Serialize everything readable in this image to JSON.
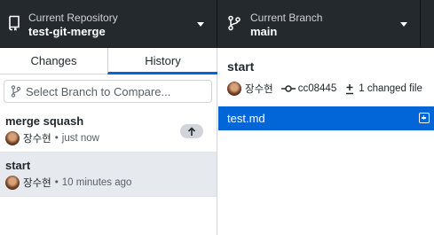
{
  "toolbar": {
    "repository": {
      "description": "Current Repository",
      "title": "test-git-merge",
      "icon": "repo-icon"
    },
    "branch": {
      "description": "Current Branch",
      "title": "main",
      "icon": "git-branch-icon"
    }
  },
  "sidebar": {
    "tabs": [
      {
        "label": "Changes",
        "selected": false
      },
      {
        "label": "History",
        "selected": true
      }
    ],
    "compare": {
      "placeholder": "Select Branch to Compare..."
    },
    "commits": [
      {
        "title": "merge squash",
        "author": "장수현",
        "time": "just now",
        "unpushed": true,
        "selected": false
      },
      {
        "title": "start",
        "author": "장수현",
        "time": "10 minutes ago",
        "unpushed": false,
        "selected": true
      }
    ]
  },
  "detail": {
    "title": "start",
    "author": "장수현",
    "sha": "cc08445",
    "files_changed": "1 changed file",
    "files": [
      {
        "name": "test.md",
        "status": "added"
      }
    ]
  },
  "colors": {
    "toolbar_bg": "#24292e",
    "accent": "#0366d6",
    "selected_bg": "#e6e9ed"
  }
}
